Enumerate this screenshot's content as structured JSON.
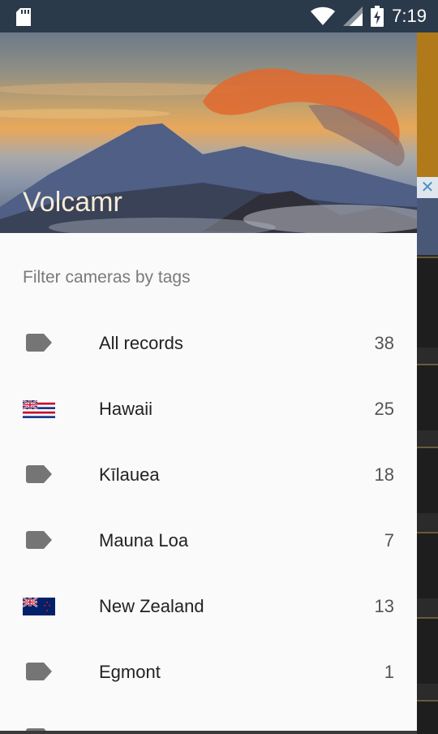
{
  "status_bar": {
    "time": "7:19",
    "icons": [
      "sd-card-icon",
      "wifi-icon",
      "signal-icon",
      "battery-charging-icon"
    ]
  },
  "drawer": {
    "app_title": "Volcamr",
    "filter_label": "Filter cameras by tags",
    "items": [
      {
        "label": "All records",
        "count": "38",
        "icon": "tag-icon"
      },
      {
        "label": "Hawaii",
        "count": "25",
        "icon": "hawaii-flag-icon"
      },
      {
        "label": "Kīlauea",
        "count": "18",
        "icon": "tag-icon"
      },
      {
        "label": "Mauna Loa",
        "count": "7",
        "icon": "tag-icon"
      },
      {
        "label": "New Zealand",
        "count": "13",
        "icon": "new-zealand-flag-icon"
      },
      {
        "label": "Egmont",
        "count": "1",
        "icon": "tag-icon"
      }
    ]
  },
  "background_ad": {
    "close_glyph": "✕"
  },
  "colors": {
    "drawer_bg": "#fafafa",
    "tag_icon": "#757575",
    "title_text": "#f5ecd6"
  }
}
